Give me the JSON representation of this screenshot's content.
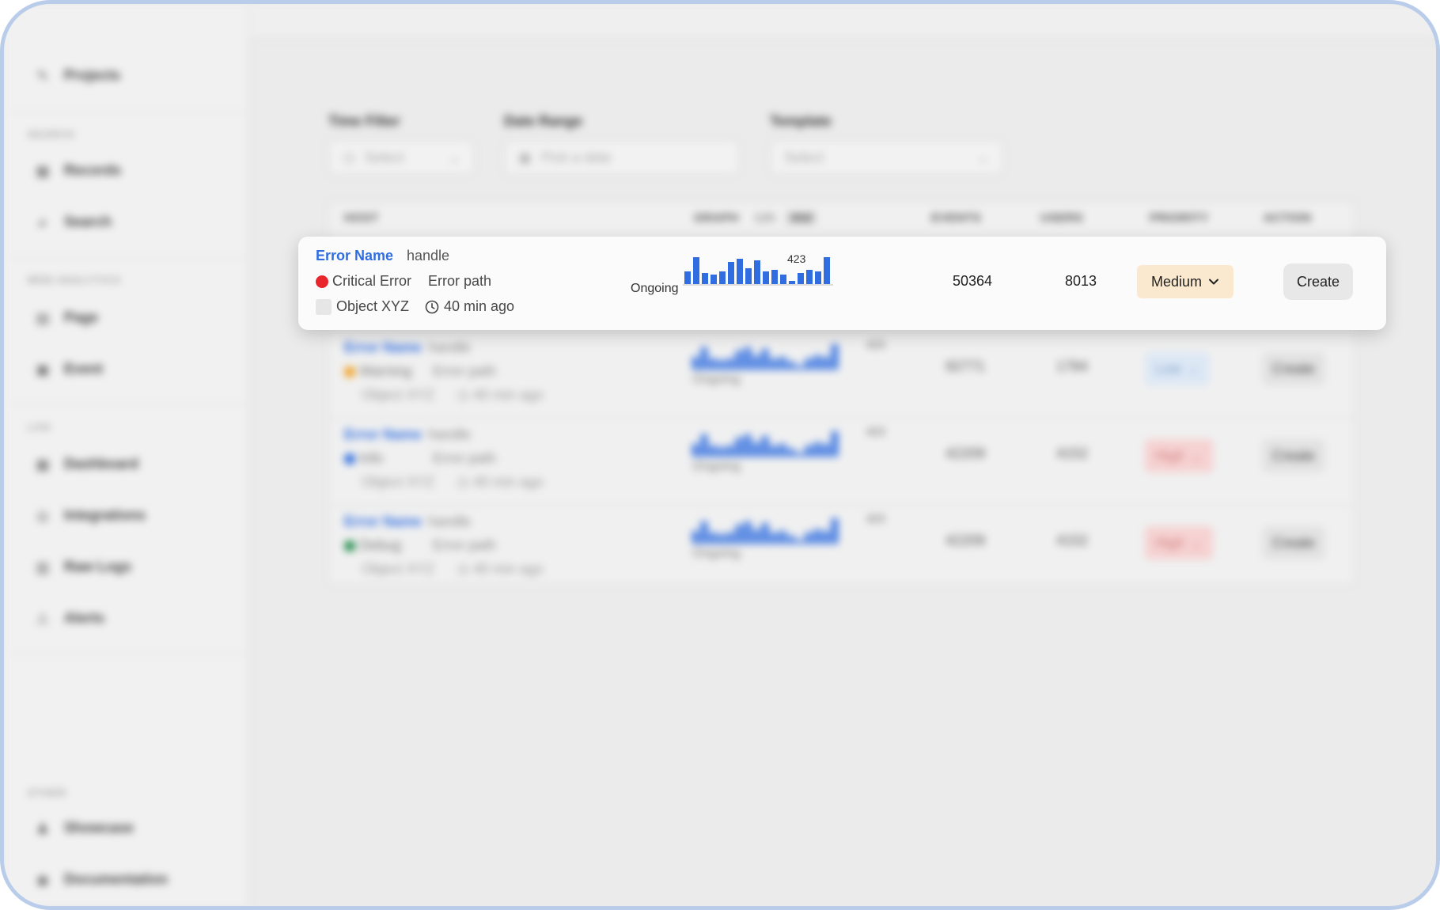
{
  "sidebar": {
    "top_item": "Projects",
    "sections": [
      {
        "title": "SEARCH",
        "items": [
          "Records",
          "Search"
        ]
      },
      {
        "title": "WEB ANALYTICS",
        "items": [
          "Page",
          "Event"
        ]
      },
      {
        "title": "LOG",
        "items": [
          "Dashboard",
          "Integrations",
          "Raw Logs",
          "Alerts"
        ]
      },
      {
        "title": "OTHER",
        "items": [
          "Showcase",
          "Documentation"
        ]
      }
    ]
  },
  "filters": {
    "time": {
      "label": "Time Filter",
      "placeholder": "Select"
    },
    "date": {
      "label": "Date Range",
      "placeholder": "Pick a date"
    },
    "template": {
      "label": "Template",
      "placeholder": "Select"
    }
  },
  "table": {
    "headers": {
      "host": "HOST",
      "graph": "GRAPH",
      "range_a": "12h",
      "range_b": "30d",
      "events": "EVENTS",
      "users": "USERS",
      "priority": "PRIORITY",
      "action": "ACTION"
    },
    "rows": [
      {
        "name": "Error Name",
        "handle": "handle",
        "level": "Warning",
        "path": "Error path",
        "object": "Object XYZ",
        "time": "40 min ago",
        "count": "423",
        "status": "Ongoing",
        "events": "92771",
        "users": "1784",
        "priority": "Low",
        "action": "Create"
      },
      {
        "name": "Error Name",
        "handle": "handle",
        "level": "Info",
        "path": "Error path",
        "object": "Object XYZ",
        "time": "40 min ago",
        "count": "423",
        "status": "Ongoing",
        "events": "42209",
        "users": "4152",
        "priority": "High",
        "action": "Create"
      },
      {
        "name": "Error Name",
        "handle": "handle",
        "level": "Debug",
        "path": "Error path",
        "object": "Object XYZ",
        "time": "40 min ago",
        "count": "423",
        "status": "Ongoing",
        "events": "42209",
        "users": "4152",
        "priority": "High",
        "action": "Create"
      }
    ]
  },
  "highlight": {
    "name": "Error Name",
    "handle": "handle",
    "level": "Critical Error",
    "path": "Error path",
    "object": "Object XYZ",
    "time": "40 min ago",
    "count": "423",
    "status": "Ongoing",
    "events": "50364",
    "users": "8013",
    "priority": "Medium",
    "action": "Create"
  },
  "colors": {
    "accent": "#2f6de0",
    "critical": "#e8262c",
    "warning": "#f0a020",
    "info": "#2f6de0",
    "debug": "#1e8a4a",
    "medium_bg": "#fbe9cf",
    "low_bg": "#dde8f5",
    "high_bg": "#f6d2d2"
  },
  "icons": {
    "projects": "pencil-icon",
    "records": "grid-icon",
    "search": "magnifier-icon",
    "page": "page-icon",
    "event": "calendar-icon",
    "dashboard": "dashboard-icon",
    "integrations": "plug-icon",
    "raw_logs": "logs-icon",
    "alerts": "alert-icon",
    "showcase": "user-icon",
    "documentation": "doc-icon",
    "time": "clock-icon",
    "chevron": "chevron-down-icon"
  }
}
